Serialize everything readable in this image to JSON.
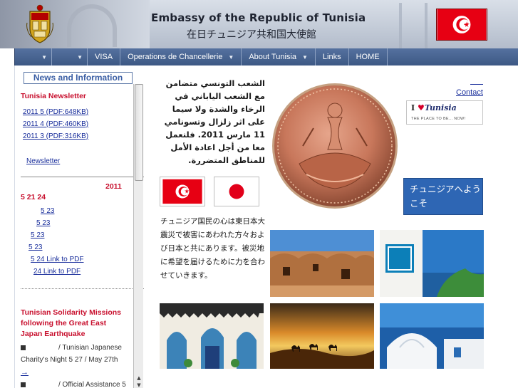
{
  "header": {
    "title_en": "Embassy of the Republic of Tunisia",
    "title_jp": "在日チュニジア共和国大使館"
  },
  "nav": {
    "items": [
      {
        "label": ""
      },
      {
        "label": ""
      },
      {
        "label": "VISA"
      },
      {
        "label": "Operations de Chancellerie"
      },
      {
        "label": "About Tunisia"
      },
      {
        "label": "Links"
      },
      {
        "label": "HOME"
      }
    ]
  },
  "left": {
    "news_title": "News and Information",
    "newsletter_heading": "Tunisia Newsletter",
    "newsletter_links": [
      "2011 5  (PDF:648KB)",
      "2011 4  (PDF:460KB)",
      "2011 3  (PDF:316KB)"
    ],
    "newsletter_more": "Newsletter",
    "year": "2011",
    "date_heading": "5  21    24",
    "date_links": [
      "5 23",
      "5 23",
      "5 23",
      "5 23",
      "5 24 Link to PDF",
      "24 Link to PDF"
    ],
    "solidarity_heading": "Tunisian Solidarity Missions following the Great East Japan Earthquake",
    "solidarity_items": [
      {
        "text": "/ Tunisian Japanese",
        "text2": "Charity's Night 5 27 / May 27th"
      },
      {
        "text": "/ Official Assistance  5"
      }
    ],
    "arrow": "→"
  },
  "center": {
    "arabic_text": "الشعب التونسي متضامن مع الشعب الياباني في الرخاء والشدة ولا سيما على اثر زلزال وتسونامي 11 مارس 2011. فلنعمل معا من أجل اعادة الأمل للمناطق المتضررة.",
    "jp_message": "チュニジア国民の心は東日本大震災で被害にあわれた方々および日本と共にあります。被災地に希望を届けるために力を合わせていきます。"
  },
  "right": {
    "contact_label": "Contact",
    "ilove_line1_heart": "I ",
    "ilove_line1_brand": "Tunisia",
    "ilove_line2": "THE PLACE TO BE... NOW!",
    "welcome_text": "チュニジアへようこそ"
  },
  "colors": {
    "nav_bg": "#4a6594",
    "accent_red": "#c8102e",
    "link_blue": "#1a2f9c",
    "welcome_bg": "#2e66b4"
  }
}
